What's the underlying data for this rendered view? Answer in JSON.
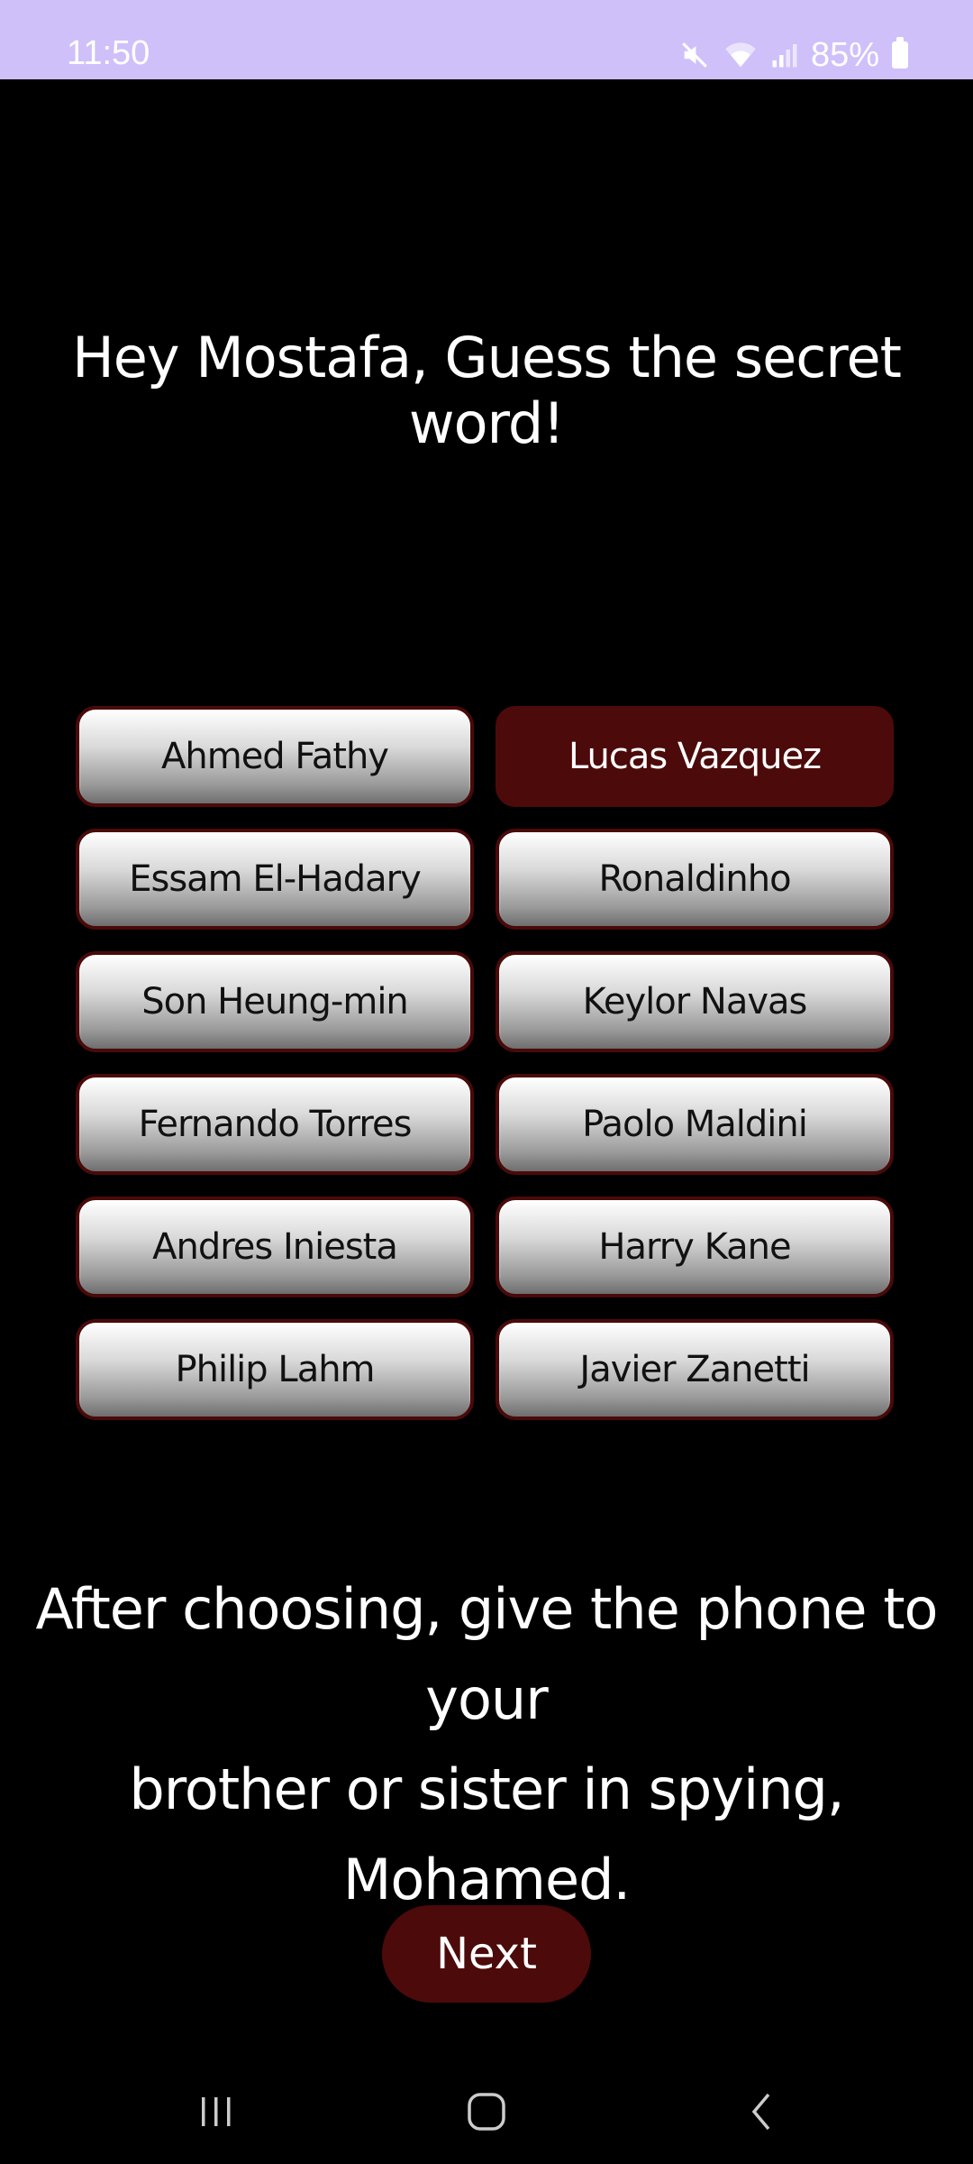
{
  "status_bar": {
    "time": "11:50",
    "battery_percent": "85%",
    "icons": [
      "mute-icon",
      "wifi-icon",
      "signal-icon",
      "battery-icon"
    ]
  },
  "game": {
    "prompt": "Hey Mostafa, Guess the secret word!",
    "options": [
      {
        "label": "Ahmed Fathy",
        "selected": false
      },
      {
        "label": "Lucas Vazquez",
        "selected": true
      },
      {
        "label": "Essam El-Hadary",
        "selected": false
      },
      {
        "label": "Ronaldinho",
        "selected": false
      },
      {
        "label": "Son Heung-min",
        "selected": false
      },
      {
        "label": "Keylor Navas",
        "selected": false
      },
      {
        "label": "Fernando Torres",
        "selected": false
      },
      {
        "label": "Paolo Maldini",
        "selected": false
      },
      {
        "label": "Andres Iniesta",
        "selected": false
      },
      {
        "label": "Harry Kane",
        "selected": false
      },
      {
        "label": "Philip Lahm",
        "selected": false
      },
      {
        "label": "Javier Zanetti",
        "selected": false
      }
    ],
    "instruction_line1": "After choosing, give the phone to your",
    "instruction_line2": "brother or sister in spying, Mohamed.",
    "next_label": "Next"
  },
  "colors": {
    "status_bar_bg": "#cfc0fa",
    "background": "#000000",
    "accent": "#4d0a0a"
  },
  "nav": [
    "recent-apps-icon",
    "home-icon",
    "back-icon"
  ]
}
